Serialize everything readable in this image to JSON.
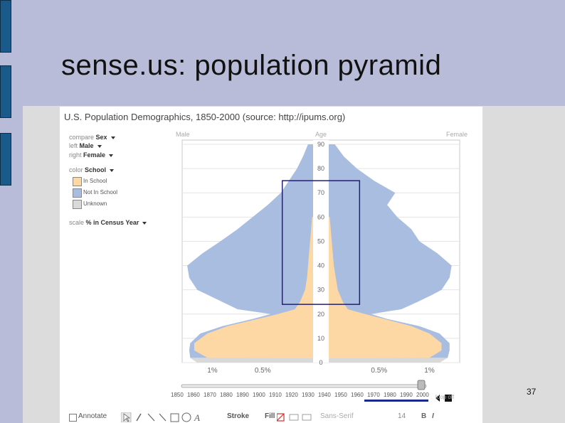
{
  "slide": {
    "title": "sense.us: population pyramid",
    "number": "37"
  },
  "app": {
    "title": "U.S. Population Demographics, 1850-2000 (source: http://ipums.org)",
    "controls": {
      "compare_label": "compare",
      "compare_value": "Sex",
      "left_label": "left",
      "left_value": "Male",
      "right_label": "right",
      "right_value": "Female",
      "color_label": "color",
      "color_value": "School",
      "scale_label": "scale",
      "scale_value": "% in Census Year"
    },
    "legend": [
      {
        "label": "In School",
        "color": "#fdd8a5"
      },
      {
        "label": "Not In School",
        "color": "#a8bde0"
      },
      {
        "label": "Unknown",
        "color": "#d9d9d9"
      }
    ],
    "timeline": {
      "years": [
        "1850",
        "1860",
        "1870",
        "1880",
        "1890",
        "1900",
        "1910",
        "1920",
        "1930",
        "1940",
        "1950",
        "1960",
        "1970",
        "1980",
        "1990",
        "2000"
      ],
      "selected": "2000",
      "loop": "loop off"
    },
    "toolbar": {
      "annotate": "Annotate",
      "stroke": "Stroke",
      "fill": "Fill",
      "font": "Sans-Serif",
      "size": "14"
    }
  },
  "chart_data": {
    "type": "area",
    "header_left": "Male",
    "header_center": "Age",
    "header_right": "Female",
    "age_ticks": [
      "90",
      "80",
      "70",
      "60",
      "50",
      "40",
      "30",
      "20",
      "10",
      "0"
    ],
    "x_ticks_left": [
      "1%",
      "0.5%"
    ],
    "x_ticks_right": [
      "0.5%",
      "1%"
    ],
    "xlim": [
      -1.3,
      1.3
    ],
    "ylim": [
      0,
      90
    ],
    "ages": [
      0,
      2,
      5,
      8,
      12,
      15,
      18,
      20,
      22,
      25,
      28,
      30,
      35,
      40,
      45,
      50,
      55,
      60,
      65,
      70,
      75,
      80,
      85,
      90
    ],
    "series": [
      {
        "name": "Not In School",
        "color": "#a8bde0",
        "male": [
          1.15,
          1.22,
          1.23,
          1.22,
          1.12,
          0.9,
          0.6,
          0.42,
          0.75,
          0.9,
          1.05,
          1.15,
          1.23,
          1.25,
          1.1,
          0.92,
          0.75,
          0.6,
          0.45,
          0.32,
          0.24,
          0.16,
          0.1,
          0.05
        ],
        "female": [
          1.1,
          1.18,
          1.2,
          1.2,
          1.1,
          0.9,
          0.58,
          0.42,
          0.72,
          0.88,
          1.03,
          1.12,
          1.2,
          1.22,
          1.08,
          0.9,
          0.82,
          0.68,
          0.58,
          0.66,
          0.45,
          0.28,
          0.15,
          0.06
        ]
      },
      {
        "name": "In School",
        "color": "#fdd8a5",
        "male": [
          0.05,
          1.05,
          1.18,
          1.18,
          1.05,
          0.85,
          0.55,
          0.35,
          0.18,
          0.13,
          0.1,
          0.08,
          0.06,
          0.05,
          0.04,
          0.03,
          0.02,
          0.01,
          0,
          0,
          0,
          0,
          0,
          0
        ],
        "female": [
          0.05,
          1.0,
          1.12,
          1.12,
          1.0,
          0.82,
          0.55,
          0.36,
          0.19,
          0.14,
          0.11,
          0.09,
          0.07,
          0.05,
          0.04,
          0.03,
          0.02,
          0.01,
          0,
          0,
          0,
          0,
          0,
          0
        ]
      },
      {
        "name": "Unknown",
        "color": "#d9d9d9",
        "male": [
          1.15,
          1.22,
          0,
          0,
          0,
          0,
          0,
          0,
          0,
          0,
          0,
          0,
          0,
          0,
          0,
          0,
          0,
          0,
          0,
          0,
          0,
          0,
          0,
          0
        ],
        "female": [
          1.1,
          1.18,
          0,
          0,
          0,
          0,
          0,
          0,
          0,
          0,
          0,
          0,
          0,
          0,
          0,
          0,
          0,
          0,
          0,
          0,
          0,
          0,
          0,
          0
        ]
      }
    ],
    "highlight": {
      "age_min": 24,
      "age_max": 75,
      "pct_min": -0.2,
      "pct_max": 0.2,
      "color": "#22226e"
    }
  }
}
